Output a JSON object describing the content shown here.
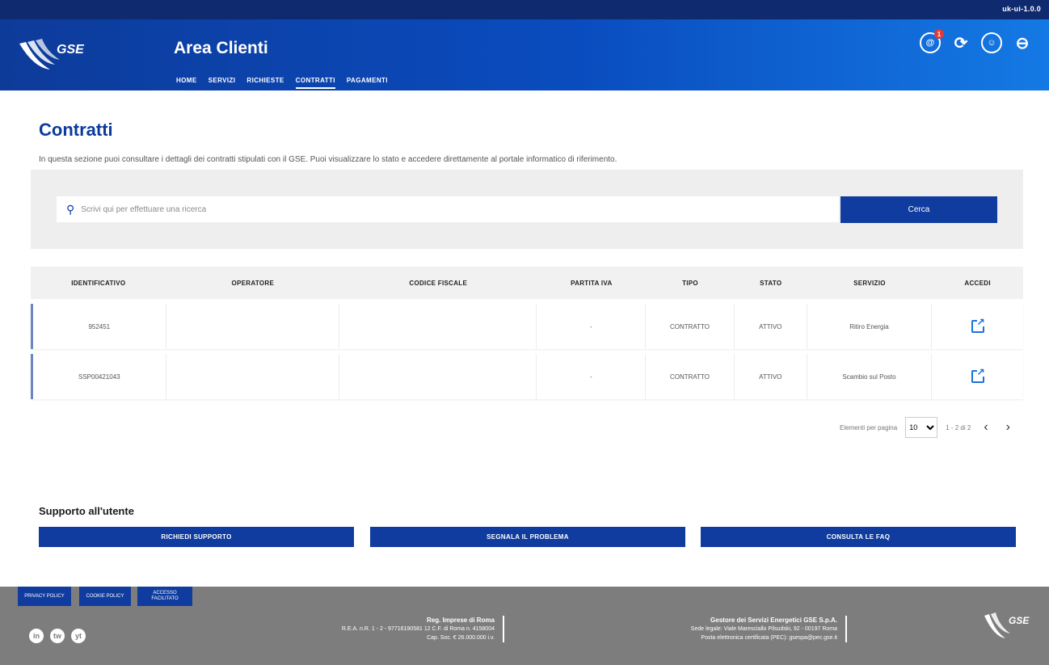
{
  "top": {
    "right_text": "uk-ui-1.0.0"
  },
  "header": {
    "logo_text": "GSE",
    "title": "Area Clienti",
    "nav": [
      "HOME",
      "SERVIZI",
      "RICHIESTE",
      "CONTRATTI",
      "PAGAMENTI"
    ],
    "active_nav": "CONTRATTI",
    "icons": [
      "notifications-icon",
      "chat-support-icon",
      "user-profile-icon",
      "logout-icon"
    ],
    "notification_badge": "1"
  },
  "page": {
    "title": "Contratti",
    "description": "In questa sezione puoi consultare i dettagli dei contratti stipulati con il GSE. Puoi visualizzare lo stato e accedere direttamente al portale informatico di riferimento."
  },
  "search": {
    "placeholder": "Scrivi qui per effettuare una ricerca",
    "button_label": "Cerca"
  },
  "table": {
    "headers": [
      "IDENTIFICATIVO",
      "OPERATORE",
      "CODICE FISCALE",
      "PARTITA IVA",
      "TIPO",
      "STATO",
      "SERVIZIO",
      "ACCEDI"
    ],
    "rows": [
      {
        "id": "952451",
        "operatore": "",
        "cf": "",
        "piva": "-",
        "tipo": "CONTRATTO",
        "stato": "ATTIVO",
        "servizio": "Ritiro Energia"
      },
      {
        "id": "SSP00421043",
        "operatore": "",
        "cf": "",
        "piva": "-",
        "tipo": "CONTRATTO",
        "stato": "ATTIVO",
        "servizio": "Scambio sul Posto"
      }
    ]
  },
  "pager": {
    "per_page_label": "Elementi per pagina",
    "per_page_value": "10",
    "range_text": "1 - 2 di 2"
  },
  "support": {
    "title": "Supporto all'utente",
    "buttons": [
      "RICHIEDI SUPPORTO",
      "SEGNALA IL PROBLEMA",
      "CONSULTA LE FAQ"
    ]
  },
  "footer": {
    "buttons": [
      "PRIVACY POLICY",
      "COOKIE POLICY",
      "ACCESSO FACILITATO"
    ],
    "social": [
      "in",
      "tw",
      "yt"
    ],
    "block1": {
      "title": "Reg. Imprese di Roma",
      "line1": "R.E.A. n.R. 1 - 2 - 97716190581 12 C.F. di Roma n. 4158004",
      "line2": "Cap. Soc. € 26.000.000 i.v."
    },
    "block2": {
      "title": "Gestore dei Servizi Energetici GSE S.p.A.",
      "line1": "Sede legale: Viale Maresciallo Pilsudski, 92 - 00197 Roma",
      "line2": "Posta elettronica certificata (PEC): gsespa@pec.gse.it"
    },
    "logo_text": "GSE"
  }
}
